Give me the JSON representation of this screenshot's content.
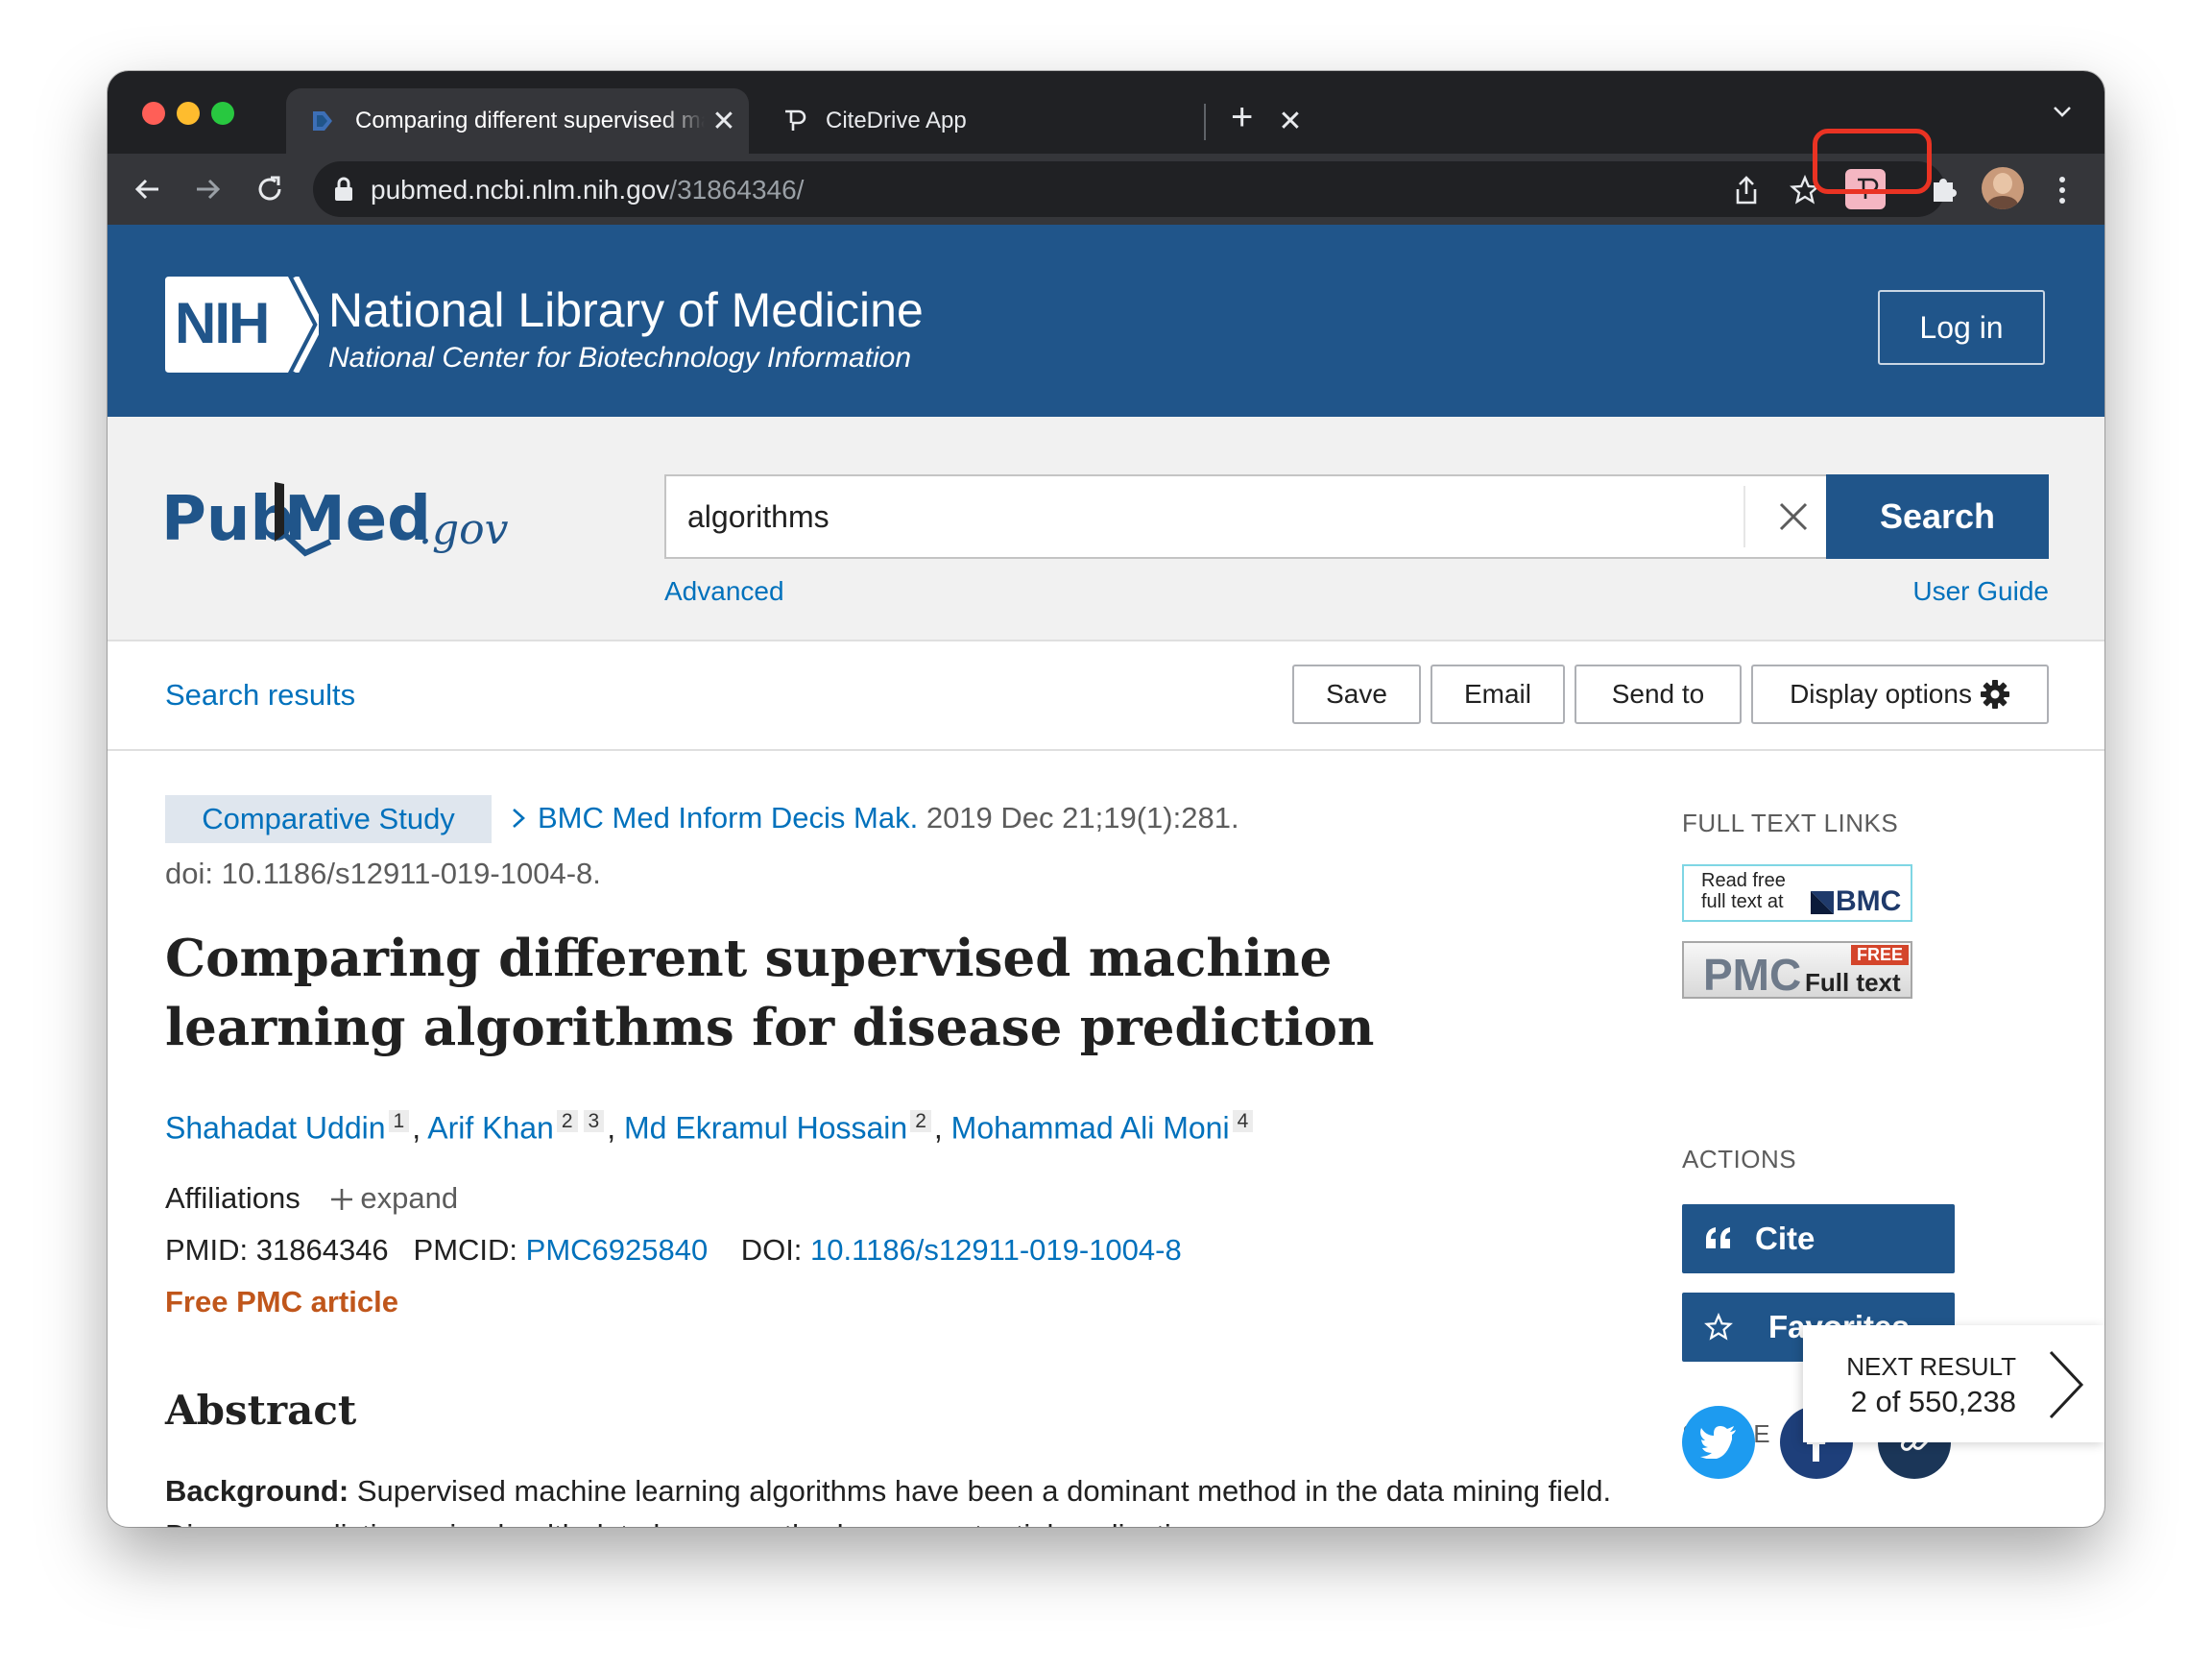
{
  "browser": {
    "tabs": [
      {
        "title": "Comparing different supervised machine learning algorithms for disease prediction",
        "close": "✕"
      },
      {
        "title": "CiteDrive App",
        "close": "✕"
      }
    ],
    "new_tab": "+",
    "url_host": "pubmed.ncbi.nlm.nih.gov",
    "url_path": "/31864346/",
    "highlight_color": "#ea3323"
  },
  "nih": {
    "logo_text": "NIH",
    "title": "National Library of Medicine",
    "subtitle": "National Center for Biotechnology Information",
    "login": "Log in",
    "color": "#20558a"
  },
  "search": {
    "logo": "PubMed.gov",
    "query": "algorithms",
    "button": "Search",
    "advanced": "Advanced",
    "user_guide": "User Guide"
  },
  "actions_bar": {
    "search_results": "Search results",
    "save": "Save",
    "email": "Email",
    "send_to": "Send to",
    "display_options": "Display options"
  },
  "article": {
    "pub_type": "Comparative Study",
    "journal": "BMC Med Inform Decis Mak.",
    "citation": "2019 Dec 21;19(1):281.",
    "doi_line": "doi: 10.1186/s12911-019-1004-8.",
    "title": "Comparing different supervised machine learning algorithms for disease prediction",
    "authors": [
      {
        "name": "Shahadat Uddin",
        "aff": "1"
      },
      {
        "name": "Arif Khan",
        "aff": "2",
        "aff2": "3"
      },
      {
        "name": "Md Ekramul Hossain",
        "aff": "2"
      },
      {
        "name": "Mohammad Ali Moni",
        "aff": "4"
      }
    ],
    "affiliations_label": "Affiliations",
    "expand": "expand",
    "pmid_label": "PMID:",
    "pmid": "31864346",
    "pmcid_label": "PMCID:",
    "pmcid": "PMC6925840",
    "doi_label": "DOI:",
    "doi": "10.1186/s12911-019-1004-8",
    "free_pmc": "Free PMC article",
    "abstract_heading": "Abstract",
    "abstract_label": "Background:",
    "abstract_text": "Supervised machine learning algorithms have been a dominant method in the data mining field. Disease prediction using health data has recently shown a potential application"
  },
  "sidebar": {
    "full_text_links": "FULL TEXT LINKS",
    "bmc_line1": "Read free",
    "bmc_line2": "full text at",
    "bmc_brand": "BMC",
    "pmc_brand": "PMC",
    "pmc_free": "FREE",
    "pmc_full": "Full text",
    "actions": "ACTIONS",
    "cite": "Cite",
    "favorites": "Favorites",
    "share": "SHARE",
    "next_result": "NEXT RESULT",
    "next_count": "2 of 550,238"
  }
}
